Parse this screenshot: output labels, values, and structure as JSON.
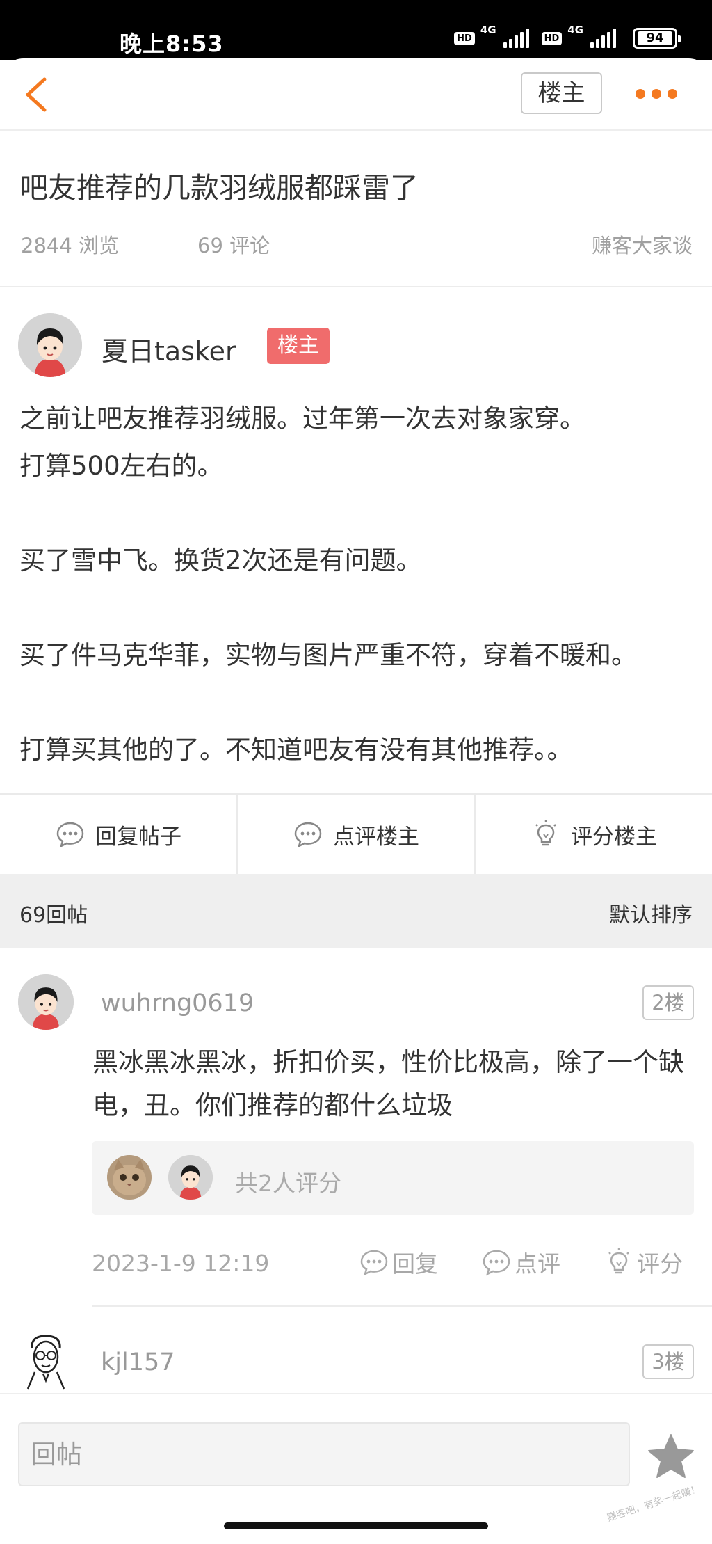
{
  "status": {
    "time": "晚上8:53",
    "hd1": "HD",
    "net1": "4G",
    "hd2": "HD",
    "net2": "4G",
    "battery": "94"
  },
  "topbar": {
    "op_filter_label": "楼主"
  },
  "post": {
    "title": "吧友推荐的几款羽绒服都踩雷了",
    "views": "2844 浏览",
    "comments": "69 评论",
    "board": "赚客大家谈",
    "author": "夏日tasker",
    "author_badge": "楼主",
    "body": [
      "之前让吧友推荐羽绒服。过年第一次去对象家穿。",
      "打算500左右的。",
      "",
      "买了雪中飞。换货2次还是有问题。",
      "",
      "买了件马克华菲，实物与图片严重不符，穿着不暖和。",
      "",
      "打算买其他的了。不知道吧友有没有其他推荐。。"
    ]
  },
  "actions": {
    "reply_post": "回复帖子",
    "comment_op": "点评楼主",
    "rate_op": "评分楼主"
  },
  "replies_header": {
    "count": "69回帖",
    "sort": "默认排序"
  },
  "comments": [
    {
      "user": "wuhrng0619",
      "floor": "2楼",
      "text": "黑冰黑冰黑冰，折扣价买，性价比极高，除了一个缺电，丑。你们推荐的都什么垃圾",
      "rating_summary": "共2人评分",
      "time": "2023-1-9 12:19",
      "reply_label": "回复",
      "comment_label": "点评",
      "rate_label": "评分"
    },
    {
      "user": "kjl157",
      "floor": "3楼"
    }
  ],
  "bottom": {
    "reply_placeholder": "回帖"
  },
  "watermark": "赚客吧，有奖一起赚！"
}
